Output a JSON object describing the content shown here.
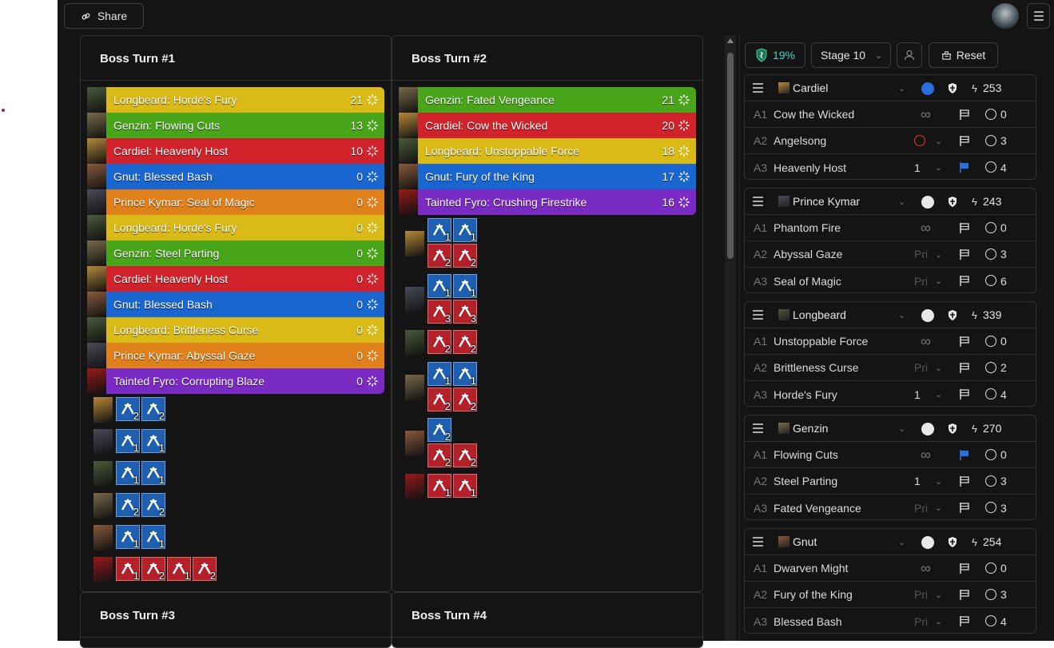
{
  "topbar": {
    "share_label": "Share"
  },
  "turns": [
    {
      "title": "Boss Turn #1",
      "actions": [
        {
          "label": "Longbeard: Horde's Fury",
          "value": "21",
          "color": "#d9ba17",
          "portrait": "#4a5a3a"
        },
        {
          "label": "Genzin: Flowing Cuts",
          "value": "13",
          "color": "#48a51a",
          "portrait": "#7a6a4a"
        },
        {
          "label": "Cardiel: Heavenly Host",
          "value": "10",
          "color": "#d1232b",
          "portrait": "#b88a3a"
        },
        {
          "label": "Gnut: Blessed Bash",
          "value": "0",
          "color": "#1a66d1",
          "portrait": "#8a5a3a"
        },
        {
          "label": "Prince Kymar: Seal of Magic",
          "value": "0",
          "color": "#e0801a",
          "portrait": "#4a4a5a"
        },
        {
          "label": "Longbeard: Horde's Fury",
          "value": "0",
          "color": "#d9ba17",
          "portrait": "#4a5a3a"
        },
        {
          "label": "Genzin: Steel Parting",
          "value": "0",
          "color": "#48a51a",
          "portrait": "#7a6a4a"
        },
        {
          "label": "Cardiel: Heavenly Host",
          "value": "0",
          "color": "#d1232b",
          "portrait": "#b88a3a"
        },
        {
          "label": "Gnut: Blessed Bash",
          "value": "0",
          "color": "#1a66d1",
          "portrait": "#8a5a3a"
        },
        {
          "label": "Longbeard: Brittleness Curse",
          "value": "0",
          "color": "#d9ba17",
          "portrait": "#4a5a3a"
        },
        {
          "label": "Prince Kymar: Abyssal Gaze",
          "value": "0",
          "color": "#e0801a",
          "portrait": "#4a4a5a"
        },
        {
          "label": "Tainted Fyro: Corrupting Blaze",
          "value": "0",
          "color": "#7a2bc4",
          "portrait": "#9a1a1a"
        }
      ],
      "effects": [
        {
          "portrait": "#b88a3a",
          "lines": [
            [
              {
                "kind": "buff",
                "n": "2"
              },
              {
                "kind": "buff",
                "n": "2"
              }
            ]
          ]
        },
        {
          "portrait": "#4a4a5a",
          "lines": [
            [
              {
                "kind": "buff",
                "n": "1"
              },
              {
                "kind": "buff",
                "n": "1"
              }
            ]
          ]
        },
        {
          "portrait": "#4a5a3a",
          "lines": [
            [
              {
                "kind": "buff",
                "n": "1"
              },
              {
                "kind": "buff",
                "n": "1"
              }
            ]
          ]
        },
        {
          "portrait": "#7a6a4a",
          "lines": [
            [
              {
                "kind": "buff",
                "n": "2"
              },
              {
                "kind": "buff",
                "n": "2"
              }
            ]
          ]
        },
        {
          "portrait": "#8a5a3a",
          "lines": [
            [
              {
                "kind": "buff",
                "n": "1"
              },
              {
                "kind": "buff",
                "n": "1"
              }
            ]
          ]
        },
        {
          "portrait": "#9a1a1a",
          "lines": [
            [
              {
                "kind": "debuff",
                "n": "1"
              },
              {
                "kind": "debuff",
                "n": "2"
              },
              {
                "kind": "debuff",
                "n": "1"
              },
              {
                "kind": "debuff",
                "n": "2"
              }
            ]
          ]
        }
      ]
    },
    {
      "title": "Boss Turn #2",
      "actions": [
        {
          "label": "Genzin: Fated Vengeance",
          "value": "21",
          "color": "#48a51a",
          "portrait": "#7a6a4a"
        },
        {
          "label": "Cardiel: Cow the Wicked",
          "value": "20",
          "color": "#d1232b",
          "portrait": "#b88a3a"
        },
        {
          "label": "Longbeard: Unstoppable Force",
          "value": "18",
          "color": "#d9ba17",
          "portrait": "#4a5a3a"
        },
        {
          "label": "Gnut: Fury of the King",
          "value": "17",
          "color": "#1a66d1",
          "portrait": "#8a5a3a"
        },
        {
          "label": "Tainted Fyro: Crushing Firestrike",
          "value": "16",
          "color": "#7a2bc4",
          "portrait": "#9a1a1a"
        }
      ],
      "effects": [
        {
          "portrait": "#b88a3a",
          "lines": [
            [
              {
                "kind": "buff",
                "n": "1"
              },
              {
                "kind": "buff",
                "n": "1"
              }
            ],
            [
              {
                "kind": "debuff",
                "n": "2"
              },
              {
                "kind": "debuff",
                "n": "2"
              }
            ]
          ]
        },
        {
          "portrait": "#4a4a5a",
          "lines": [
            [
              {
                "kind": "buff",
                "n": "1"
              },
              {
                "kind": "buff",
                "n": "1"
              }
            ],
            [
              {
                "kind": "debuff",
                "n": "3"
              },
              {
                "kind": "debuff",
                "n": "3"
              }
            ]
          ]
        },
        {
          "portrait": "#4a5a3a",
          "lines": [
            [
              {
                "kind": "debuff",
                "n": "2"
              },
              {
                "kind": "debuff",
                "n": "2"
              }
            ]
          ]
        },
        {
          "portrait": "#7a6a4a",
          "lines": [
            [
              {
                "kind": "buff",
                "n": "1"
              },
              {
                "kind": "buff",
                "n": "1"
              }
            ],
            [
              {
                "kind": "debuff",
                "n": "2"
              },
              {
                "kind": "debuff",
                "n": "2"
              }
            ]
          ]
        },
        {
          "portrait": "#8a5a3a",
          "lines": [
            [
              {
                "kind": "buff",
                "n": "2"
              }
            ],
            [
              {
                "kind": "debuff",
                "n": "2"
              },
              {
                "kind": "debuff",
                "n": "2"
              }
            ]
          ]
        },
        {
          "portrait": "#9a1a1a",
          "lines": [
            [
              {
                "kind": "debuff",
                "n": "1"
              },
              {
                "kind": "debuff",
                "n": "1"
              }
            ]
          ]
        }
      ]
    },
    {
      "title": "Boss Turn #3",
      "actions": [],
      "effects": []
    },
    {
      "title": "Boss Turn #4",
      "actions": [],
      "effects": []
    }
  ],
  "toolbar": {
    "percent": "19%",
    "stage": "Stage 10",
    "reset": "Reset"
  },
  "champions": [
    {
      "name": "Cardiel",
      "speed": "253",
      "portrait": "#b88a3a",
      "blue_circle": true,
      "skills": [
        {
          "slot": "A1",
          "name": "Cow the Wicked",
          "prio": "∞",
          "flag": "outline",
          "cd": "0"
        },
        {
          "slot": "A2",
          "name": "Angelsong",
          "prio": "⊘",
          "flag": "outline",
          "cd": "3"
        },
        {
          "slot": "A3",
          "name": "Heavenly Host",
          "prio": "1",
          "flag": "blue",
          "cd": "4"
        }
      ]
    },
    {
      "name": "Prince Kymar",
      "speed": "243",
      "portrait": "#4a4a5a",
      "blue_circle": false,
      "skills": [
        {
          "slot": "A1",
          "name": "Phantom Fire",
          "prio": "∞",
          "flag": "outline",
          "cd": "0"
        },
        {
          "slot": "A2",
          "name": "Abyssal Gaze",
          "prio": "Pri",
          "flag": "outline",
          "cd": "3"
        },
        {
          "slot": "A3",
          "name": "Seal of Magic",
          "prio": "Pri",
          "flag": "outline",
          "cd": "6"
        }
      ]
    },
    {
      "name": "Longbeard",
      "speed": "339",
      "portrait": "#4a5a3a",
      "blue_circle": false,
      "skills": [
        {
          "slot": "A1",
          "name": "Unstoppable Force",
          "prio": "∞",
          "flag": "outline",
          "cd": "0"
        },
        {
          "slot": "A2",
          "name": "Brittleness Curse",
          "prio": "Pri",
          "flag": "outline",
          "cd": "2"
        },
        {
          "slot": "A3",
          "name": "Horde's Fury",
          "prio": "1",
          "flag": "outline",
          "cd": "4"
        }
      ]
    },
    {
      "name": "Genzin",
      "speed": "270",
      "portrait": "#7a6a4a",
      "blue_circle": false,
      "skills": [
        {
          "slot": "A1",
          "name": "Flowing Cuts",
          "prio": "∞",
          "flag": "blue",
          "cd": "0"
        },
        {
          "slot": "A2",
          "name": "Steel Parting",
          "prio": "1",
          "flag": "outline",
          "cd": "3"
        },
        {
          "slot": "A3",
          "name": "Fated Vengeance",
          "prio": "Pri",
          "flag": "outline",
          "cd": "3"
        }
      ]
    },
    {
      "name": "Gnut",
      "speed": "254",
      "portrait": "#8a5a3a",
      "blue_circle": false,
      "skills": [
        {
          "slot": "A1",
          "name": "Dwarven Might",
          "prio": "∞",
          "flag": "outline",
          "cd": "0"
        },
        {
          "slot": "A2",
          "name": "Fury of the King",
          "prio": "Pri",
          "flag": "outline",
          "cd": "3"
        },
        {
          "slot": "A3",
          "name": "Blessed Bash",
          "prio": "Pri",
          "flag": "outline",
          "cd": "4"
        }
      ]
    }
  ]
}
